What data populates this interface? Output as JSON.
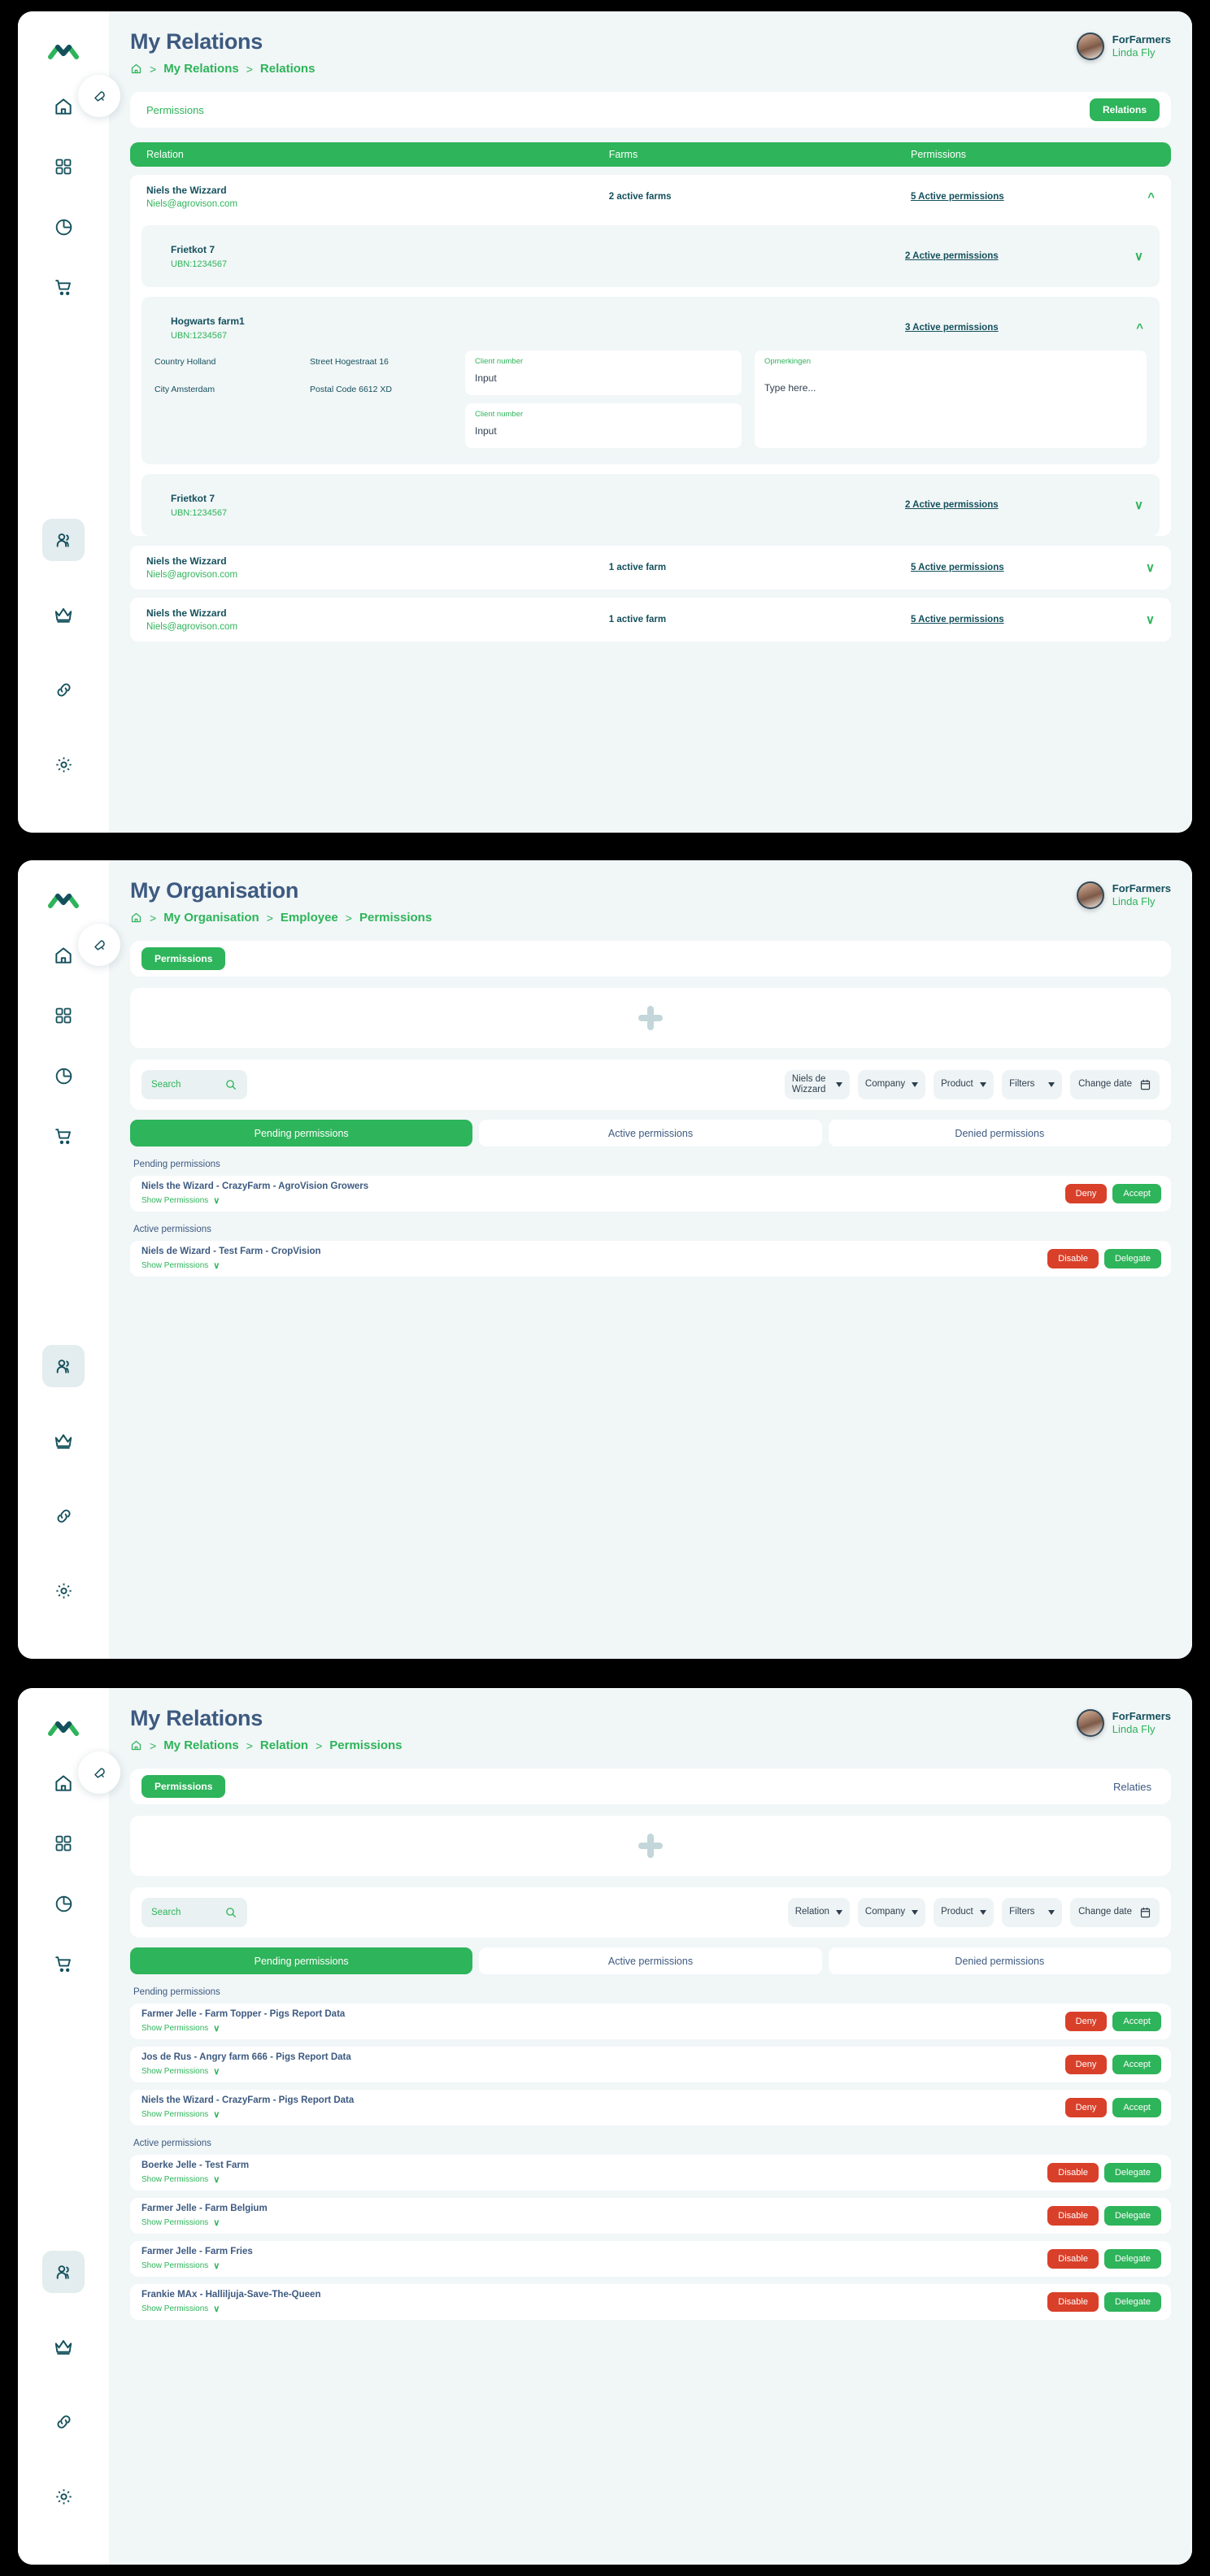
{
  "brand": {
    "logo_icon": "mountain-logo-icon"
  },
  "sidebar": {
    "notification_icon": "bell-icon",
    "top_items": [
      {
        "icon": "home-icon",
        "name": "home"
      },
      {
        "icon": "grid-dashboard-icon",
        "name": "dashboard"
      },
      {
        "icon": "pie-chart-icon",
        "name": "reports"
      },
      {
        "icon": "shopping-cart-icon",
        "name": "shop"
      }
    ],
    "bottom_items": [
      {
        "icon": "users-icon",
        "name": "relations",
        "active": true
      },
      {
        "icon": "crown-icon",
        "name": "premium",
        "active": false
      },
      {
        "icon": "link-icon",
        "name": "connections",
        "active": false
      },
      {
        "icon": "gear-icon",
        "name": "settings",
        "active": false
      }
    ]
  },
  "user": {
    "org": "ForFarmers",
    "name": "Linda Fly",
    "avatar_icon": "user-avatar"
  },
  "panel1": {
    "title": "My Relations",
    "breadcrumb": {
      "home_icon": "home-icon",
      "items": [
        "My Relations",
        "Relations"
      ]
    },
    "pillbar": {
      "left_label": "Permissions",
      "right_button": "Relations"
    },
    "table_headers": [
      "Relation",
      "Farms",
      "Permissions"
    ],
    "rows": [
      {
        "name": "Niels the Wizzard",
        "email": "Niels@agrovison.com",
        "farms": "2 active farms",
        "permissions": "5 Active permissions",
        "expanded": true,
        "chevron": "chevron-up",
        "farms_list": [
          {
            "name": "Frietkot 7",
            "ubn": "UBN:1234567",
            "permissions": "2 Active permissions",
            "expanded": false,
            "chevron": "chevron-down"
          },
          {
            "name": "Hogwarts farm1",
            "ubn": "UBN:1234567",
            "permissions": "3 Active permissions",
            "expanded": true,
            "chevron": "chevron-up",
            "details": {
              "country": "Country Holland",
              "city": "City Amsterdam",
              "street": "Street Hogestraat 16",
              "postal": "Postal Code 6612 XD",
              "field1_label": "Client number",
              "field1_value": "Input",
              "field2_label": "Client number",
              "field2_value": "Input",
              "notes_label": "Opmerkingen",
              "notes_placeholder": "Type here..."
            }
          },
          {
            "name": "Frietkot 7",
            "ubn": "UBN:1234567",
            "permissions": "2 Active permissions",
            "expanded": false,
            "chevron": "chevron-down"
          }
        ]
      },
      {
        "name": "Niels the Wizzard",
        "email": "Niels@agrovison.com",
        "farms": "1 active farm",
        "permissions": "5 Active permissions",
        "expanded": false,
        "chevron": "chevron-down"
      },
      {
        "name": "Niels the Wizzard",
        "email": "Niels@agrovison.com",
        "farms": "1 active farm",
        "permissions": "5 Active permissions",
        "expanded": false,
        "chevron": "chevron-down"
      }
    ]
  },
  "panel2": {
    "title": "My Organisation",
    "breadcrumb": {
      "home_icon": "home-icon",
      "items": [
        "My Organisation",
        "Employee",
        "Permissions"
      ]
    },
    "pillbar": {
      "left_button": "Permissions"
    },
    "add_card": {
      "icon": "plus-icon"
    },
    "filters": {
      "search_placeholder": "Search",
      "search_icon": "search-icon",
      "dropdowns": [
        "Niels de Wizzard",
        "Company",
        "Product",
        "Filters"
      ],
      "date_label": "Change date",
      "date_icon": "calendar-icon"
    },
    "tabs": [
      {
        "label": "Pending permissions",
        "active": true
      },
      {
        "label": "Active permissions",
        "active": false
      },
      {
        "label": "Denied permissions",
        "active": false
      }
    ],
    "sections": [
      {
        "label": "Pending permissions",
        "items": [
          {
            "title": "Niels the Wizard -  CrazyFarm   -   AgroVision Growers",
            "show": "Show Permissions",
            "chevron": "chevron-down",
            "actions": [
              {
                "label": "Deny",
                "kind": "deny"
              },
              {
                "label": "Accept",
                "kind": "accept"
              }
            ]
          }
        ]
      },
      {
        "label": "Active permissions",
        "items": [
          {
            "title": "Niels de Wizard - Test Farm   -   CropVision",
            "show": "Show Permissions",
            "chevron": "chevron-down",
            "actions": [
              {
                "label": "Disable",
                "kind": "disable"
              },
              {
                "label": "Delegate",
                "kind": "delegate"
              }
            ]
          }
        ]
      }
    ]
  },
  "panel3": {
    "title": "My Relations",
    "breadcrumb": {
      "home_icon": "home-icon",
      "items": [
        "My Relations",
        "Relation",
        "Permissions"
      ]
    },
    "pillbar": {
      "left_button": "Permissions",
      "right_label": "Relaties"
    },
    "add_card": {
      "icon": "plus-icon"
    },
    "filters": {
      "search_placeholder": "Search",
      "search_icon": "search-icon",
      "dropdowns": [
        "Relation",
        "Company",
        "Product",
        "Filters"
      ],
      "date_label": "Change date",
      "date_icon": "calendar-icon"
    },
    "tabs": [
      {
        "label": "Pending permissions",
        "active": true
      },
      {
        "label": "Active permissions",
        "active": false
      },
      {
        "label": "Denied permissions",
        "active": false
      }
    ],
    "sections": [
      {
        "label": "Pending permissions",
        "items": [
          {
            "title": "Farmer Jelle - Farm Topper  -  Pigs Report Data",
            "show": "Show Permissions",
            "chevron": "chevron-down",
            "actions": [
              {
                "label": "Deny",
                "kind": "deny"
              },
              {
                "label": "Accept",
                "kind": "accept"
              }
            ]
          },
          {
            "title": "Jos de Rus - Angry farm 666  -  Pigs Report Data",
            "show": "Show Permissions",
            "chevron": "chevron-down",
            "actions": [
              {
                "label": "Deny",
                "kind": "deny"
              },
              {
                "label": "Accept",
                "kind": "accept"
              }
            ]
          },
          {
            "title": "Niels the Wizard -  CrazyFarm  -  Pigs Report Data",
            "show": "Show Permissions",
            "chevron": "chevron-down",
            "actions": [
              {
                "label": "Deny",
                "kind": "deny"
              },
              {
                "label": "Accept",
                "kind": "accept"
              }
            ]
          }
        ]
      },
      {
        "label": "Active permissions",
        "items": [
          {
            "title": "Boerke Jelle - Test Farm",
            "show": "Show Permissions",
            "chevron": "chevron-down",
            "actions": [
              {
                "label": "Disable",
                "kind": "disable"
              },
              {
                "label": "Delegate",
                "kind": "delegate"
              }
            ]
          },
          {
            "title": "Farmer Jelle - Farm Belgium",
            "show": "Show Permissions",
            "chevron": "chevron-down",
            "actions": [
              {
                "label": "Disable",
                "kind": "disable"
              },
              {
                "label": "Delegate",
                "kind": "delegate"
              }
            ]
          },
          {
            "title": "Farmer Jelle - Farm Fries",
            "show": "Show Permissions",
            "chevron": "chevron-down",
            "actions": [
              {
                "label": "Disable",
                "kind": "disable"
              },
              {
                "label": "Delegate",
                "kind": "delegate"
              }
            ]
          },
          {
            "title": "Frankie MAx  - Halliljuja-Save-The-Queen",
            "show": "Show Permissions",
            "chevron": "chevron-down",
            "actions": [
              {
                "label": "Disable",
                "kind": "disable"
              },
              {
                "label": "Delegate",
                "kind": "delegate"
              }
            ]
          }
        ]
      }
    ]
  },
  "colors": {
    "green": "#2eb45a",
    "dark_teal": "#14505c",
    "slate": "#3d5a80",
    "red": "#d9402a",
    "page_bg": "#f1f6f7"
  }
}
